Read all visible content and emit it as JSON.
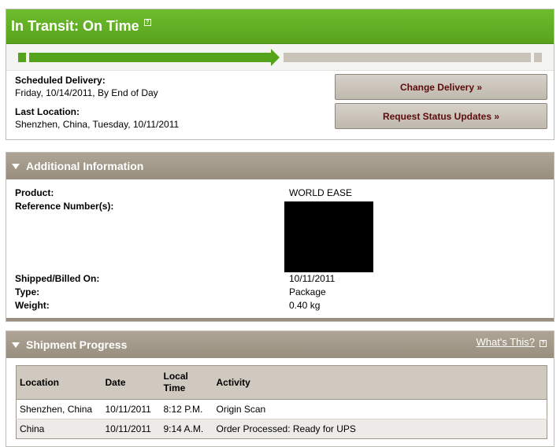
{
  "status": {
    "title": "In Transit: On Time",
    "help_glyph": "?",
    "progress_fraction": 0.5
  },
  "delivery": {
    "scheduled_label": "Scheduled Delivery:",
    "scheduled_value": "Friday, 10/14/2011, By End of Day",
    "last_location_label": "Last Location:",
    "last_location_value": "Shenzhen, China, Tuesday, 10/11/2011"
  },
  "actions": {
    "change_delivery": "Change Delivery »",
    "request_updates": "Request Status Updates »"
  },
  "additional_info": {
    "title": "Additional Information",
    "product_label": "Product:",
    "product_value": "WORLD EASE",
    "reference_label": "Reference Number(s):",
    "shipped_label": "Shipped/Billed On:",
    "shipped_value": "10/11/2011",
    "type_label": "Type:",
    "type_value": "Package",
    "weight_label": "Weight:",
    "weight_value": "0.40 kg"
  },
  "shipment_progress": {
    "title": "Shipment Progress",
    "whats_this": "What's This?",
    "columns": {
      "location": "Location",
      "date": "Date",
      "local_time_line1": "Local",
      "local_time_line2": "Time",
      "activity": "Activity"
    },
    "rows": [
      {
        "location": "Shenzhen, China",
        "date": "10/11/2011",
        "time": "8:12 P.M.",
        "activity": "Origin Scan"
      },
      {
        "location": "China",
        "date": "10/11/2011",
        "time": "9:14 A.M.",
        "activity": "Order Processed: Ready for UPS"
      }
    ]
  },
  "colors": {
    "status_green": "#58a31c",
    "progress_done": "#55a31a",
    "progress_remaining": "#c9c3b9",
    "section_header": "#a49a8a",
    "button_text": "#5b0b0b"
  }
}
